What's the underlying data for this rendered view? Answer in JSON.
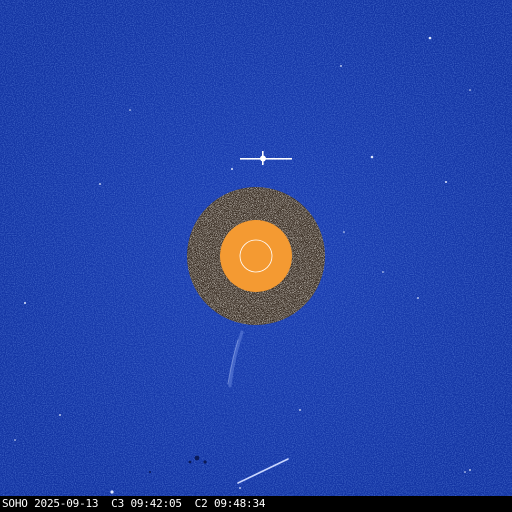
{
  "image": {
    "caption": "SOHO 2025-09-13  C3 09:42:05  C2 09:48:34"
  },
  "colors": {
    "sky": "#1436a8",
    "sky_light": "#2a55c8",
    "sun_disk": "#f49a32",
    "occulter_ring": "#5a4a3a",
    "caption_bar": "#000000",
    "caption_text": "#ffffff"
  }
}
